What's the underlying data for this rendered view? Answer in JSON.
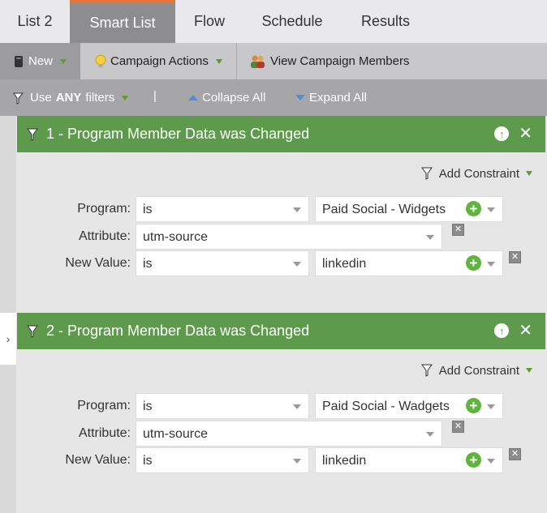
{
  "tabs": [
    "List 2",
    "Smart List",
    "Flow",
    "Schedule",
    "Results"
  ],
  "toolbar": {
    "new_label": "New",
    "campaign_actions_label": "Campaign Actions",
    "view_members_label": "View Campaign Members"
  },
  "filterbar": {
    "use_prefix": "Use",
    "use_any": "ANY",
    "use_suffix": "filters",
    "separator": "|",
    "collapse_label": "Collapse All",
    "expand_label": "Expand All"
  },
  "gutter": {
    "toggle": "›"
  },
  "filters": [
    {
      "title": "1 - Program Member Data was Changed",
      "add_constraint": "Add Constraint",
      "program_label": "Program:",
      "program_op": "is",
      "program_value": "Paid Social - Widgets",
      "attribute_label": "Attribute:",
      "attribute_value": "utm-source",
      "newvalue_label": "New Value:",
      "newvalue_op": "is",
      "newvalue_value": "linkedin"
    },
    {
      "title": "2 - Program Member Data was Changed",
      "add_constraint": "Add Constraint",
      "program_label": "Program:",
      "program_op": "is",
      "program_value": "Paid Social - Wadgets",
      "attribute_label": "Attribute:",
      "attribute_value": "utm-source",
      "newvalue_label": "New Value:",
      "newvalue_op": "is",
      "newvalue_value": "linkedin"
    }
  ],
  "colors": {
    "header_green": "#5d9a4c",
    "active_tab": "#8d8d8f",
    "tab_accent": "#e6733a",
    "plus_green": "#5fb33e"
  }
}
